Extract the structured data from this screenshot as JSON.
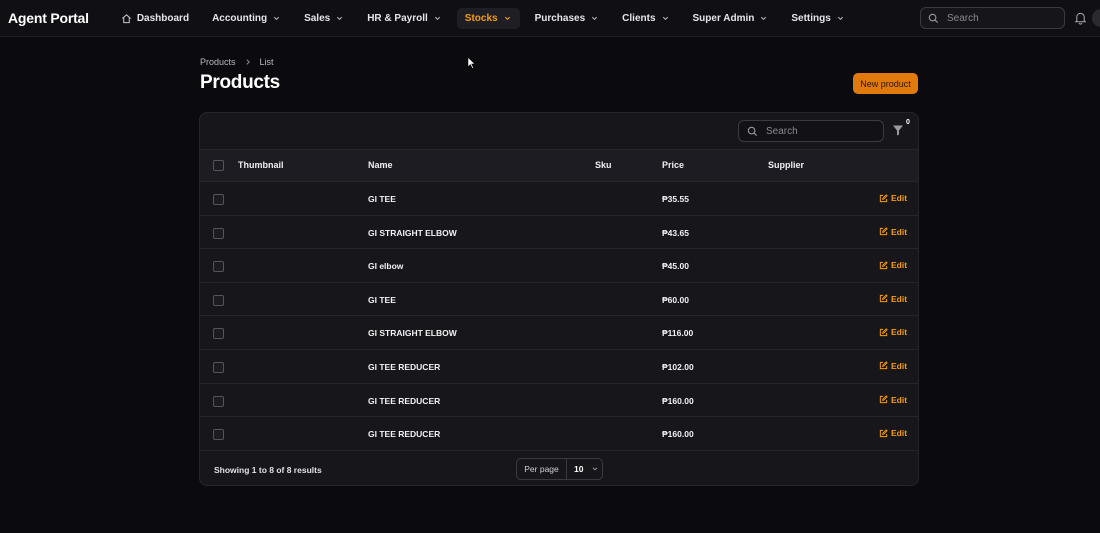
{
  "app": {
    "brand": "Agent Portal"
  },
  "nav": {
    "items": [
      {
        "label": "Dashboard",
        "icon": "home-icon"
      },
      {
        "label": "Accounting",
        "icon": "chevron-down-icon"
      },
      {
        "label": "Sales",
        "icon": "chevron-down-icon"
      },
      {
        "label": "HR & Payroll",
        "icon": "chevron-down-icon"
      },
      {
        "label": "Stocks",
        "icon": "chevron-down-icon",
        "active": true
      },
      {
        "label": "Purchases",
        "icon": "chevron-down-icon"
      },
      {
        "label": "Clients",
        "icon": "chevron-down-icon"
      },
      {
        "label": "Super Admin",
        "icon": "chevron-down-icon"
      },
      {
        "label": "Settings",
        "icon": "chevron-down-icon"
      }
    ],
    "search_placeholder": "Search"
  },
  "breadcrumb": {
    "items": [
      "Products",
      "List"
    ]
  },
  "page": {
    "title": "Products",
    "new_button": "New product"
  },
  "table": {
    "search_placeholder": "Search",
    "filter_count": "0",
    "columns": [
      "Thumbnail",
      "Name",
      "Sku",
      "Price",
      "Supplier"
    ],
    "edit_label": "Edit",
    "rows": [
      {
        "name": "GI TEE",
        "price": "₱35.55"
      },
      {
        "name": "GI STRAIGHT ELBOW",
        "price": "₱43.65"
      },
      {
        "name": "GI elbow",
        "price": "₱45.00"
      },
      {
        "name": "GI TEE",
        "price": "₱60.00"
      },
      {
        "name": "GI STRAIGHT ELBOW",
        "price": "₱116.00"
      },
      {
        "name": "GI TEE REDUCER",
        "price": "₱102.00"
      },
      {
        "name": "GI TEE REDUCER",
        "price": "₱160.00"
      },
      {
        "name": "GI TEE REDUCER",
        "price": "₱160.00"
      }
    ]
  },
  "footer": {
    "showing": "Showing 1 to 8 of 8 results",
    "per_page_label": "Per page",
    "per_page_value": "10"
  },
  "colors": {
    "accent": "#f59e0b",
    "button": "#e07a0c",
    "background": "#0b0a0e",
    "card": "#17161b"
  }
}
